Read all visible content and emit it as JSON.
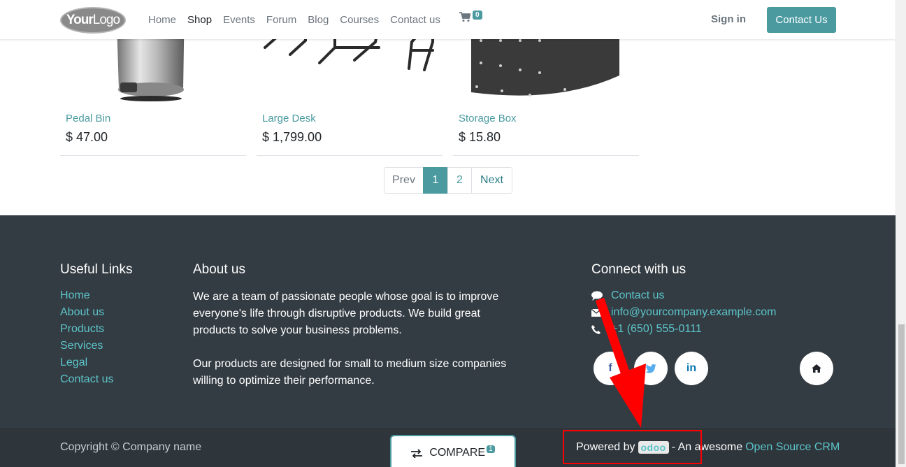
{
  "header": {
    "logo_text_bold": "Your",
    "logo_text": "Logo",
    "nav": [
      "Home",
      "Shop",
      "Events",
      "Forum",
      "Blog",
      "Courses",
      "Contact us"
    ],
    "active_nav": "Shop",
    "cart_count": "0",
    "sign_in": "Sign in",
    "contact_button": "Contact Us"
  },
  "products": [
    {
      "name": "Pedal Bin",
      "price": "$ 47.00"
    },
    {
      "name": "Large Desk",
      "price": "$ 1,799.00"
    },
    {
      "name": "Storage Box",
      "price": "$ 15.80"
    }
  ],
  "pagination": {
    "prev": "Prev",
    "pages": [
      "1",
      "2"
    ],
    "active": "1",
    "next": "Next"
  },
  "footer": {
    "useful_links_title": "Useful Links",
    "useful_links": [
      "Home",
      "About us",
      "Products",
      "Services",
      "Legal",
      "Contact us"
    ],
    "about_title": "About us",
    "about_p1": "We are a team of passionate people whose goal is to improve everyone's life through disruptive products. We build great products to solve your business problems.",
    "about_p2": "Our products are designed for small to medium size companies willing to optimize their performance.",
    "connect_title": "Connect with us",
    "connect_contact": "Contact us",
    "connect_email": "info@yourcompany.example.com",
    "connect_phone": "+1 (650) 555-0111",
    "social_icons": [
      "facebook-icon",
      "twitter-icon",
      "linkedin-icon",
      "home-icon"
    ],
    "copyright": "Copyright © Company name",
    "powered_by": "Powered by",
    "odoo": "odoo",
    "awesome": "- An awesome",
    "crm_link": "Open Source CRM"
  },
  "compare": {
    "label": "COMPARE",
    "count": "1"
  },
  "colors": {
    "accent": "#4a9aa0",
    "footer_bg": "#343c43",
    "link": "#5bc4c9",
    "annotation": "#ff0000"
  }
}
